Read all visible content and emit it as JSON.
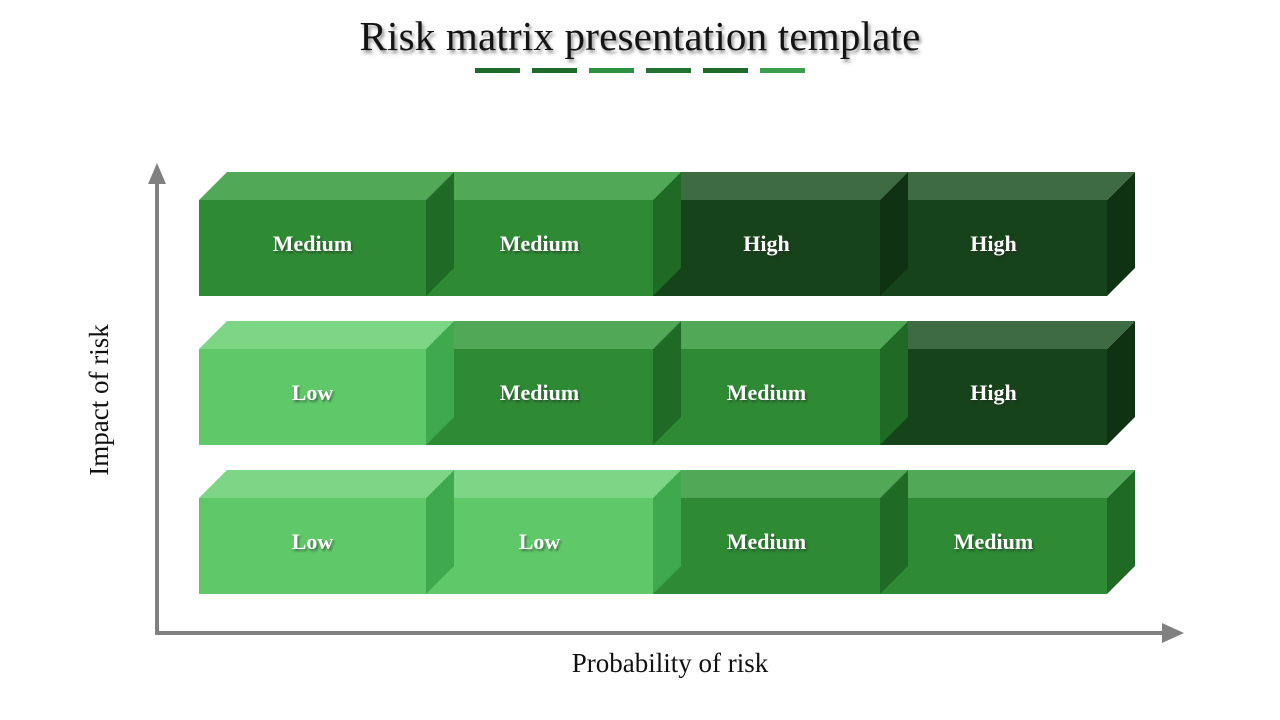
{
  "title": {
    "text": "Risk matrix presentation template",
    "dashes": [
      {
        "color": "#1e6b2c"
      },
      {
        "color": "#1e6b2c"
      },
      {
        "color": "#2e9142"
      },
      {
        "color": "#23722f"
      },
      {
        "color": "#1e6b2c"
      },
      {
        "color": "#3a9e4c"
      }
    ]
  },
  "axes": {
    "y_label": "Impact of risk",
    "x_label": "Probability of risk",
    "axis_color": "#808080",
    "y_arrow": "arrow-up-icon",
    "x_arrow": "arrow-right-icon"
  },
  "legend_levels": {
    "low": {
      "label": "Low",
      "front": "#5fc96a",
      "top": "#7cd685",
      "side": "#3faa4d"
    },
    "medium": {
      "label": "Medium",
      "front": "#2e8b34",
      "top": "#51a857",
      "side": "#1f6b26"
    },
    "high": {
      "label": "High",
      "front": "#17431a",
      "top": "#3f6b42",
      "side": "#0f3212"
    }
  },
  "chart_data": {
    "type": "heatmap",
    "title": "Risk matrix presentation template",
    "xlabel": "Probability of risk",
    "ylabel": "Impact of risk",
    "rows": 3,
    "columns": 4,
    "grid": false,
    "legend": "none",
    "cells": [
      [
        {
          "label": "Medium",
          "level": "medium",
          "row": 0,
          "col": 0
        },
        {
          "label": "Medium",
          "level": "medium",
          "row": 0,
          "col": 1
        },
        {
          "label": "High",
          "level": "high",
          "row": 0,
          "col": 2
        },
        {
          "label": "High",
          "level": "high",
          "row": 0,
          "col": 3
        }
      ],
      [
        {
          "label": "Low",
          "level": "low",
          "row": 1,
          "col": 0
        },
        {
          "label": "Medium",
          "level": "medium",
          "row": 1,
          "col": 1
        },
        {
          "label": "Medium",
          "level": "medium",
          "row": 1,
          "col": 2
        },
        {
          "label": "High",
          "level": "high",
          "row": 1,
          "col": 3
        }
      ],
      [
        {
          "label": "Low",
          "level": "low",
          "row": 2,
          "col": 0
        },
        {
          "label": "Low",
          "level": "low",
          "row": 2,
          "col": 1
        },
        {
          "label": "Medium",
          "level": "medium",
          "row": 2,
          "col": 2
        },
        {
          "label": "Medium",
          "level": "medium",
          "row": 2,
          "col": 3
        }
      ]
    ]
  }
}
